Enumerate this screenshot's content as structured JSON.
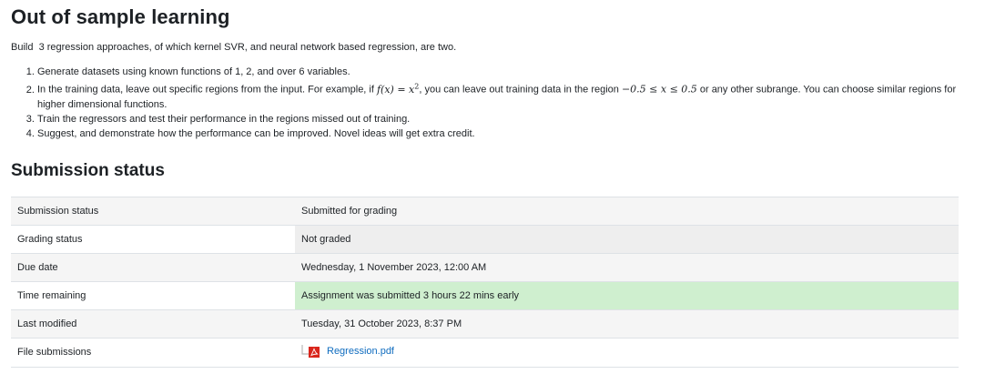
{
  "page_title": "Out of sample learning",
  "intro": "Build  3 regression approaches, of which kernel SVR, and neural network based regression, are two.",
  "tasks": [
    {
      "text": "Generate datasets using known functions of 1, 2, and over 6 variables."
    },
    {
      "before": "In the training data, leave out specific regions from the input. For example, if ",
      "math1": "f(x) = x",
      "math1_sup": "2",
      "middle": ", you can leave out training data in the region ",
      "math2": "−0.5 ≤ x ≤ 0.5",
      "after": " or any other subrange. You can choose similar regions for higher dimensional functions."
    },
    {
      "text": "Train the regressors and test their performance in the regions missed out of training."
    },
    {
      "text": "Suggest, and demonstrate how the performance can be improved. Novel ideas will get extra credit."
    }
  ],
  "section_title": "Submission status",
  "rows": [
    {
      "label": "Submission status",
      "value": "Submitted for grading"
    },
    {
      "label": "Grading status",
      "value": "Not graded"
    },
    {
      "label": "Due date",
      "value": "Wednesday, 1 November 2023, 12:00 AM"
    },
    {
      "label": "Time remaining",
      "value": "Assignment was submitted 3 hours 22 mins early"
    },
    {
      "label": "Last modified",
      "value": "Tuesday, 31 October 2023, 8:37 PM"
    },
    {
      "label": "File submissions",
      "file_name": "Regression.pdf",
      "icon": "pdf-file-icon"
    }
  ],
  "colors": {
    "link": "#0f6cbf",
    "early_highlight": "#cfefcf",
    "pdf_red": "#d9261c"
  }
}
